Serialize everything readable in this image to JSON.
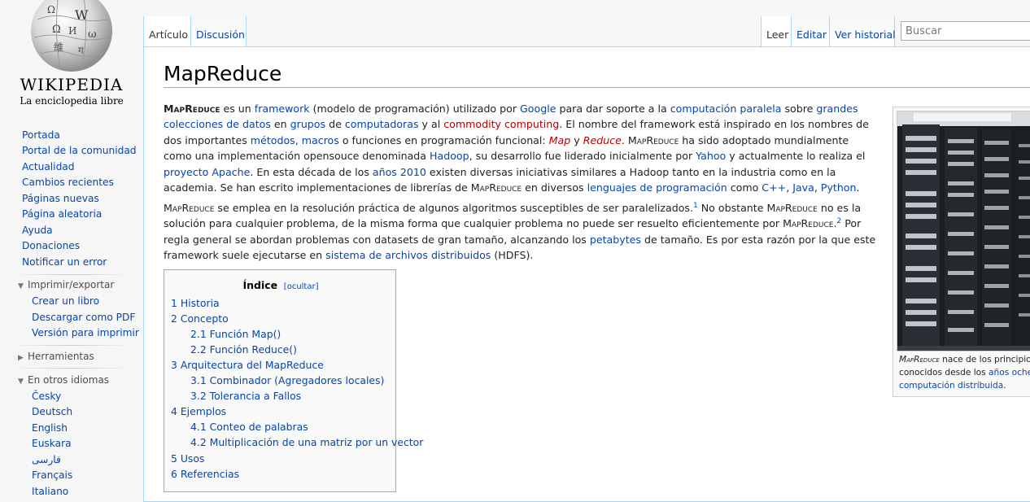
{
  "logo": {
    "wordmark": "WIKIPEDIA",
    "tagline": "La enciclopedia libre"
  },
  "sidebar": {
    "nav": [
      "Portada",
      "Portal de la comunidad",
      "Actualidad",
      "Cambios recientes",
      "Páginas nuevas",
      "Página aleatoria",
      "Ayuda",
      "Donaciones",
      "Notificar un error"
    ],
    "print_export": {
      "heading": "Imprimir/exportar",
      "items": [
        "Crear un libro",
        "Descargar como PDF",
        "Versión para imprimir"
      ]
    },
    "tools": {
      "heading": "Herramientas"
    },
    "languages": {
      "heading": "En otros idiomas",
      "items": [
        "Česky",
        "Deutsch",
        "English",
        "Euskara",
        "فارسی",
        "Français",
        "Italiano"
      ]
    }
  },
  "tabs": {
    "article": "Artículo",
    "talk": "Discusión",
    "read": "Leer",
    "edit": "Editar",
    "history": "Ver historial"
  },
  "search": {
    "placeholder": "Buscar"
  },
  "article": {
    "title": "MapReduce",
    "p1": {
      "s1": "MapReduce",
      "s2": " es un ",
      "s3": "framework",
      "s4": " (modelo de programación) utilizado por ",
      "s5": "Google",
      "s6": " para dar soporte a la ",
      "s7": "computación paralela",
      "s8": " sobre ",
      "s9": "grandes colecciones de",
      "s10": "datos",
      "s11": " en ",
      "s12": "grupos",
      "s13": " de ",
      "s14": "computadoras",
      "s15": " y al ",
      "s16": "commodity computing",
      "s17": ". El nombre del framework está inspirado en los nombres de dos importantes ",
      "s18": "métodos,",
      "s19": "macros",
      "s20": " o funciones en programación funcional: ",
      "s21": "Map",
      "s22": " y ",
      "s23": "Reduce",
      "s24": ". ",
      "s25": "MapReduce",
      "s26": " ha sido adoptado mundialmente como una implementación opensouce denominada ",
      "s27": "Hadoop",
      "s28": ", su desarrollo fue liderado inicialmente por ",
      "s29": "Yahoo",
      "s30": " y actualmente lo realiza el ",
      "s31": "proyecto Apache",
      "s32": ". En esta década de los ",
      "s33": "años 2010",
      "s34": " existen diversas iniciativas similares a Hadoop tanto en la industria como en la academia. Se han escrito implementaciones de librerías de ",
      "s35": "MapReduce",
      "s36": " en diversos ",
      "s37": "lenguajes de programación",
      "s38": " como ",
      "s39": "C++",
      "s40": ", ",
      "s41": "Java",
      "s42": ", ",
      "s43": "Python",
      "s44": "."
    },
    "p2": {
      "s1": "MapReduce",
      "s2": " se emplea en la resolución práctica de algunos algoritmos susceptibles de ser paralelizados.",
      "ref1": "1",
      "s3": " No obstante ",
      "s4": "MapReduce",
      "s5": " no es la solución para cualquier problema, de la misma forma que cualquier problema no puede ser resuelto eficientemente por ",
      "s6": "MapReduce",
      "s7": ".",
      "ref2": "2",
      "s8": " Por regla general se abordan problemas con datasets de gran tamaño, alcanzando los ",
      "s9": "petabytes",
      "s10": " de tamaño. Es por esta razón por la que este framework suele ejecutarse en ",
      "s11": "sistema de archivos distribuidos",
      "s12": " (HDFS)."
    }
  },
  "toc": {
    "title": "Índice",
    "toggle": "[ocultar]",
    "items": [
      "1 Historia",
      "2 Concepto",
      "2.1 Función Map()",
      "2.2 Función Reduce()",
      "3 Arquitectura del MapReduce",
      "3.1 Combinador (Agregadores locales)",
      "3.2 Tolerancia a Fallos",
      "4 Ejemplos",
      "4.1 Conteo de palabras",
      "4.2 Multiplicación de una matriz por un vector",
      "5 Usos",
      "6 Referencias"
    ]
  },
  "thumb": {
    "c1": "MapReduce",
    "c2": " nace de los principios",
    "c3": "conocidos desde los ",
    "c4": "años ochenta",
    "c5": "computación distribuida",
    "c6": "."
  },
  "colors": {
    "link": "#0645ad",
    "redlink": "#ba0000",
    "border": "#a7d7f9",
    "sidebar_bg": "#f6f6f6"
  }
}
